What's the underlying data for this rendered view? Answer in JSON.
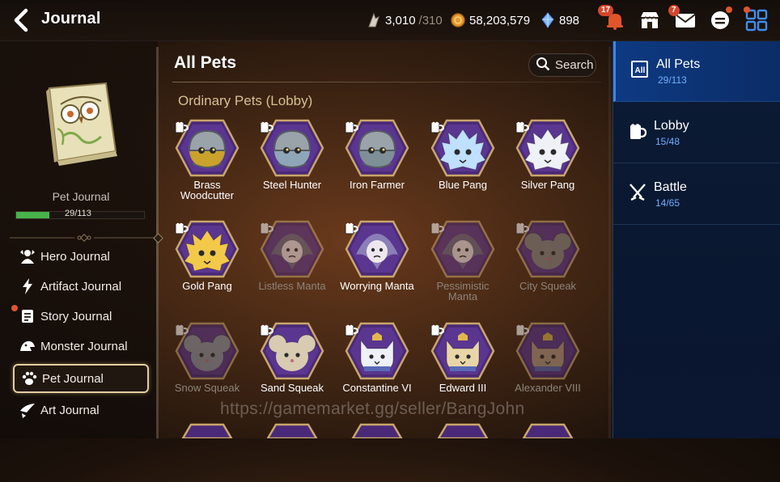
{
  "header": {
    "title": "Journal",
    "stamina": {
      "value": "3,010",
      "max": "/310"
    },
    "gold": "58,203,579",
    "crystals": "898",
    "notifications_badge": "17",
    "mail_badge": "7"
  },
  "left_panel": {
    "book_label": "Pet Journal",
    "progress_text": "29/113",
    "progress_fraction": 0.2566,
    "nav": [
      {
        "label": "Hero Journal",
        "icon": "hero-icon"
      },
      {
        "label": "Artifact Journal",
        "icon": "artifact-icon"
      },
      {
        "label": "Story Journal",
        "icon": "scroll-icon"
      },
      {
        "label": "Monster Journal",
        "icon": "monster-icon"
      },
      {
        "label": "Pet Journal",
        "icon": "paw-icon"
      },
      {
        "label": "Art Journal",
        "icon": "brush-icon"
      }
    ]
  },
  "main": {
    "title": "All Pets",
    "search_label": "Search",
    "section_title": "Ordinary Pets (Lobby)",
    "pets": [
      {
        "name": "Brass Woodcutter",
        "type": "helmet",
        "color": "#c9a22c",
        "dim": false
      },
      {
        "name": "Steel Hunter",
        "type": "helmet",
        "color": "#8fa6b8",
        "dim": false
      },
      {
        "name": "Iron Farmer",
        "type": "helmet",
        "color": "#7e8f98",
        "dim": false
      },
      {
        "name": "Blue Pang",
        "type": "fluff",
        "color": "#bfe0ff",
        "dim": false
      },
      {
        "name": "Silver Pang",
        "type": "fluff",
        "color": "#eef2f7",
        "dim": false
      },
      {
        "name": "Gold Pang",
        "type": "fluff",
        "color": "#f3c94a",
        "dim": false
      },
      {
        "name": "Listless Manta",
        "type": "manta",
        "color": "#6c6a8a",
        "dim": true
      },
      {
        "name": "Worrying Manta",
        "type": "manta",
        "color": "#8a7fb6",
        "dim": false
      },
      {
        "name": "Pessimistic Manta",
        "type": "manta",
        "color": "#6c6a8a",
        "dim": true
      },
      {
        "name": "City Squeak",
        "type": "mouse",
        "color": "#8a8a8a",
        "dim": true
      },
      {
        "name": "Snow Squeak",
        "type": "mouse",
        "color": "#9098a8",
        "dim": true
      },
      {
        "name": "Sand Squeak",
        "type": "mouse",
        "color": "#d8cbb2",
        "dim": false
      },
      {
        "name": "Constantine VI",
        "type": "cat",
        "color": "#eef1f6",
        "dim": false
      },
      {
        "name": "Edward III",
        "type": "cat",
        "color": "#e9d6a8",
        "dim": false
      },
      {
        "name": "Alexander VIII",
        "type": "cat",
        "color": "#b99d86",
        "dim": true
      }
    ],
    "watermark": "https://gamemarket.gg/seller/BangJohn"
  },
  "right_panel": {
    "categories": [
      {
        "label": "All Pets",
        "count": "29/113",
        "icon": "all-icon"
      },
      {
        "label": "Lobby",
        "count": "15/48",
        "icon": "mug-icon"
      },
      {
        "label": "Battle",
        "count": "14/65",
        "icon": "swords-icon"
      }
    ]
  },
  "colors": {
    "accent_blue": "#0e3a82",
    "progress_green": "#47b34a",
    "section_gold": "#d7bf92",
    "pet_frame_purple": "#4a2a78"
  }
}
